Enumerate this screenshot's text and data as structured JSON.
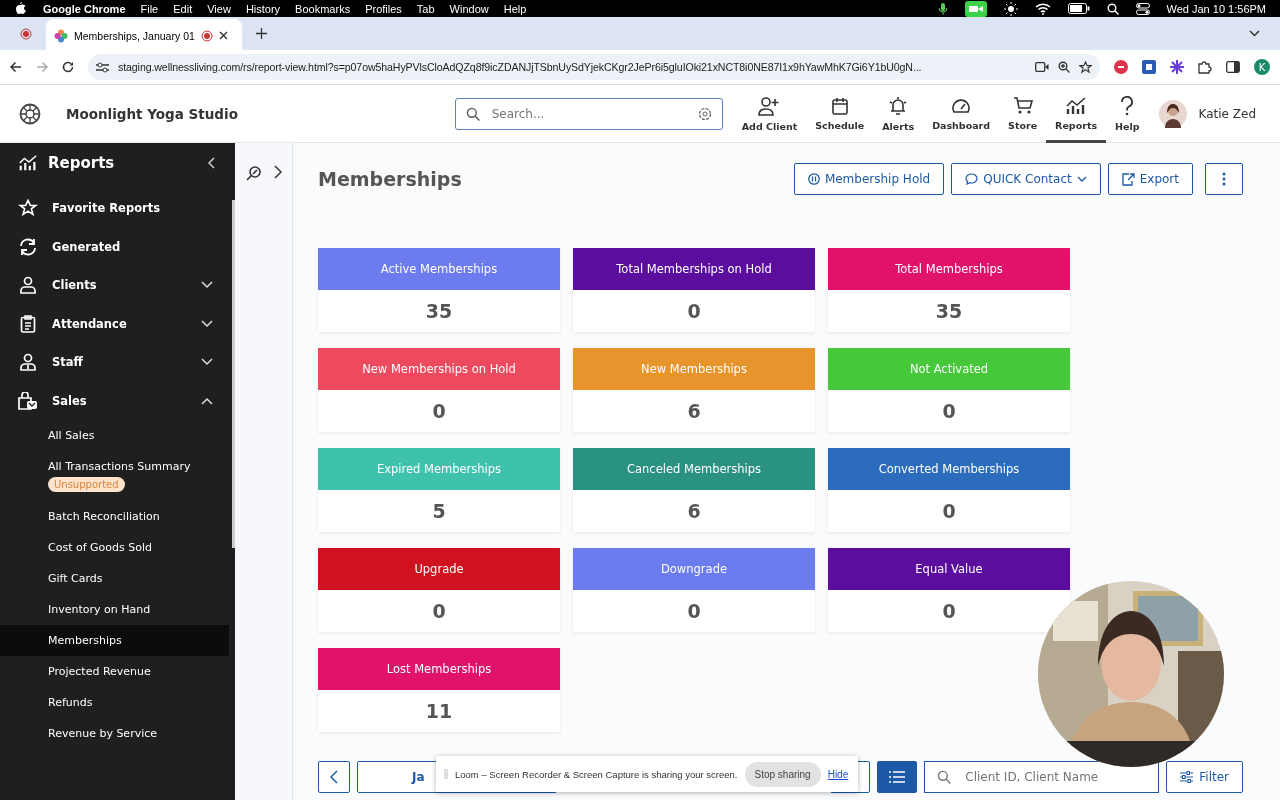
{
  "os_menu_bar": {
    "app": "Google Chrome",
    "menus": [
      "File",
      "Edit",
      "View",
      "History",
      "Bookmarks",
      "Profiles",
      "Tab",
      "Window",
      "Help"
    ],
    "clock": "Wed Jan 10  1:56PM"
  },
  "browser": {
    "tab_title": "Memberships, January 01",
    "url": "staging.wellnessliving.com/rs/report-view.html?s=p07ow5haHyPVlsCloAdQZq8f9icZDANJjTSbnUySdYjekCKgr2JePr6i5gluIOki21xNCT8i0NE87I1x9hYawMhK7Gi6Y1bU0gN...",
    "profile_initial": "K"
  },
  "header": {
    "studio": "Moonlight Yoga Studio",
    "search": {
      "placeholder": "Search..."
    },
    "nav": [
      {
        "label": "Add Client",
        "selected": false
      },
      {
        "label": "Schedule",
        "selected": false
      },
      {
        "label": "Alerts",
        "selected": false
      },
      {
        "label": "Dashboard",
        "selected": false
      },
      {
        "label": "Store",
        "selected": false
      },
      {
        "label": "Reports",
        "selected": true
      },
      {
        "label": "Help",
        "selected": false
      }
    ],
    "user": "Katie Zed"
  },
  "sidebar": {
    "title": "Reports",
    "items": [
      {
        "label": "Favorite Reports"
      },
      {
        "label": "Generated"
      },
      {
        "label": "Clients",
        "expanded": false
      },
      {
        "label": "Attendance",
        "expanded": false
      },
      {
        "label": "Staff",
        "expanded": false
      },
      {
        "label": "Sales",
        "expanded": true,
        "children": [
          {
            "label": "All Sales",
            "selected": false
          },
          {
            "label": "All Transactions Summary",
            "badge": "Unsupported",
            "selected": false
          },
          {
            "label": "Batch Reconciliation",
            "selected": false
          },
          {
            "label": "Cost of Goods Sold",
            "selected": false
          },
          {
            "label": "Gift Cards",
            "selected": false
          },
          {
            "label": "Inventory on Hand",
            "selected": false
          },
          {
            "label": "Memberships",
            "selected": true
          },
          {
            "label": "Projected Revenue",
            "selected": false
          },
          {
            "label": "Refunds",
            "selected": false
          },
          {
            "label": "Revenue by Service",
            "selected": false
          }
        ]
      }
    ]
  },
  "page": {
    "title": "Memberships",
    "actions": [
      "Membership Hold",
      "QUICK Contact",
      "Export"
    ],
    "cards": [
      {
        "label": "Active Memberships",
        "value": "35",
        "color": "#6c7cee"
      },
      {
        "label": "Total Memberships on Hold",
        "value": "0",
        "color": "#5b0e9e"
      },
      {
        "label": "Total Memberships",
        "value": "35",
        "color": "#e0126c"
      },
      {
        "label": "New Memberships on Hold",
        "value": "0",
        "color": "#ee4a5f"
      },
      {
        "label": "New Memberships",
        "value": "6",
        "color": "#e8942c"
      },
      {
        "label": "Not Activated",
        "value": "0",
        "color": "#46c83a"
      },
      {
        "label": "Expired Memberships",
        "value": "5",
        "color": "#3ec2ae"
      },
      {
        "label": "Canceled Memberships",
        "value": "6",
        "color": "#2a9282"
      },
      {
        "label": "Converted Memberships",
        "value": "0",
        "color": "#2b6cbd"
      },
      {
        "label": "Upgrade",
        "value": "0",
        "color": "#d0111f"
      },
      {
        "label": "Downgrade",
        "value": "0",
        "color": "#6c7cee"
      },
      {
        "label": "Equal Value",
        "value": "0",
        "color": "#5b0e9e"
      },
      {
        "label": "Lost Memberships",
        "value": "11",
        "color": "#e0126c"
      }
    ],
    "toolbar": {
      "date_button": "Ja",
      "search": {
        "placeholder": "Client ID, Client Name"
      },
      "filter": "Filter"
    }
  },
  "share_bar": {
    "message": "Loom – Screen Recorder & Screen Capture is sharing your screen.",
    "stop": "Stop sharing",
    "hide": "Hide"
  }
}
